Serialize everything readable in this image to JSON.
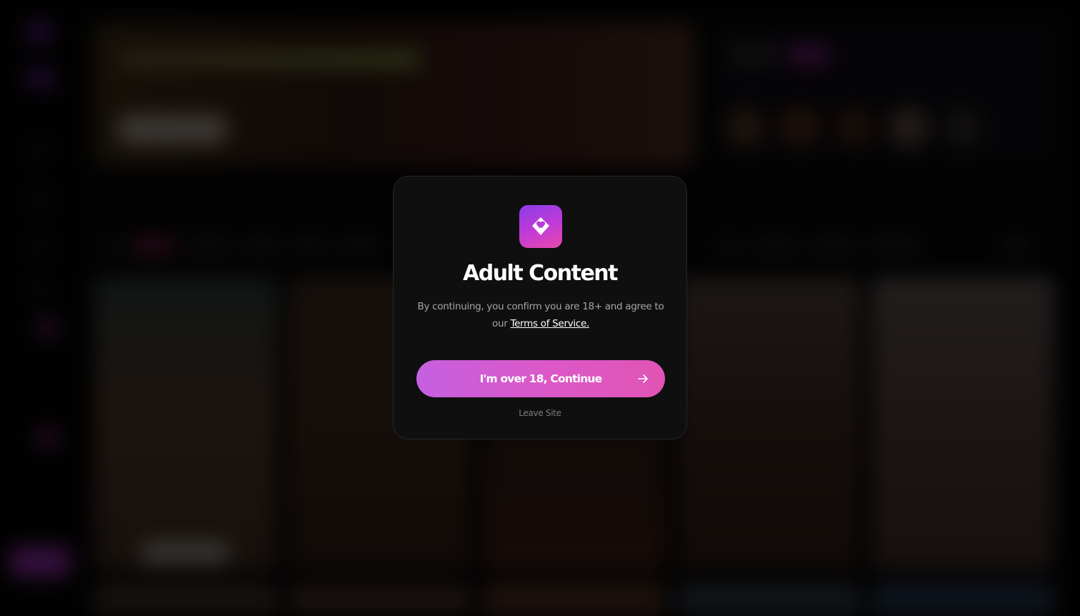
{
  "age_gate": {
    "logo_icon": "brand-heart-diamond-icon",
    "title": "Adult Content",
    "description_prefix": "By continuing, you confirm you are 18+ and agree to our",
    "terms_link": "Terms of Service.",
    "continue_label": "I'm over 18, Continue",
    "continue_icon": "arrow-right-icon",
    "leave_label": "Leave Site"
  },
  "colors": {
    "accent_start": "#8a3ce8",
    "accent_end": "#e84aa8",
    "button_gradient_start": "#c660e0",
    "button_gradient_end": "#e054b4",
    "modal_background": "#0f0f10"
  }
}
